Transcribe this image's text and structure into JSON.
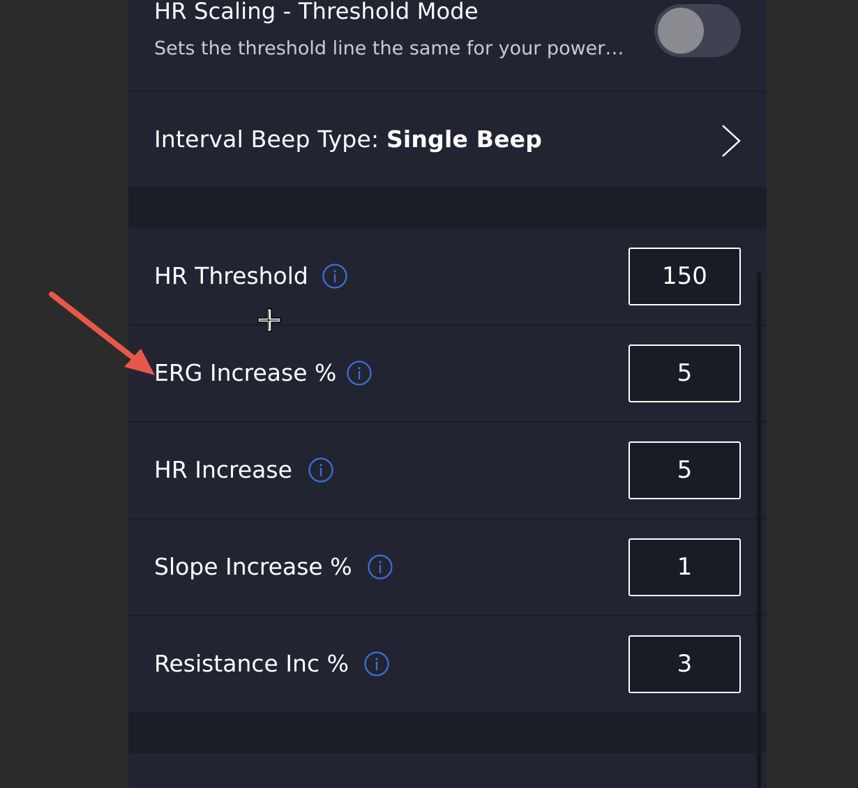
{
  "hr_scaling": {
    "title": "HR Scaling - Threshold Mode",
    "description": "Sets the threshold line the same for your power…",
    "toggle_on": false
  },
  "interval_beep": {
    "label": "Interval Beep Type: ",
    "value": "Single Beep"
  },
  "settings": [
    {
      "label": "HR Threshold",
      "value": "150"
    },
    {
      "label": "ERG Increase %",
      "value": "5"
    },
    {
      "label": "HR Increase",
      "value": "5"
    },
    {
      "label": "Slope Increase %",
      "value": "1"
    },
    {
      "label": "Resistance Inc %",
      "value": "3"
    }
  ],
  "icons": {
    "info": "info-icon",
    "chevron": "chevron-right-icon",
    "cursor": "crosshair-cursor-icon",
    "annotation": "red-arrow-annotation"
  },
  "colors": {
    "accent_info": "#3d6fe0",
    "annotation_arrow": "#e8584a",
    "panel_bg": "#222531",
    "outer_bg": "#2b2b2b"
  }
}
